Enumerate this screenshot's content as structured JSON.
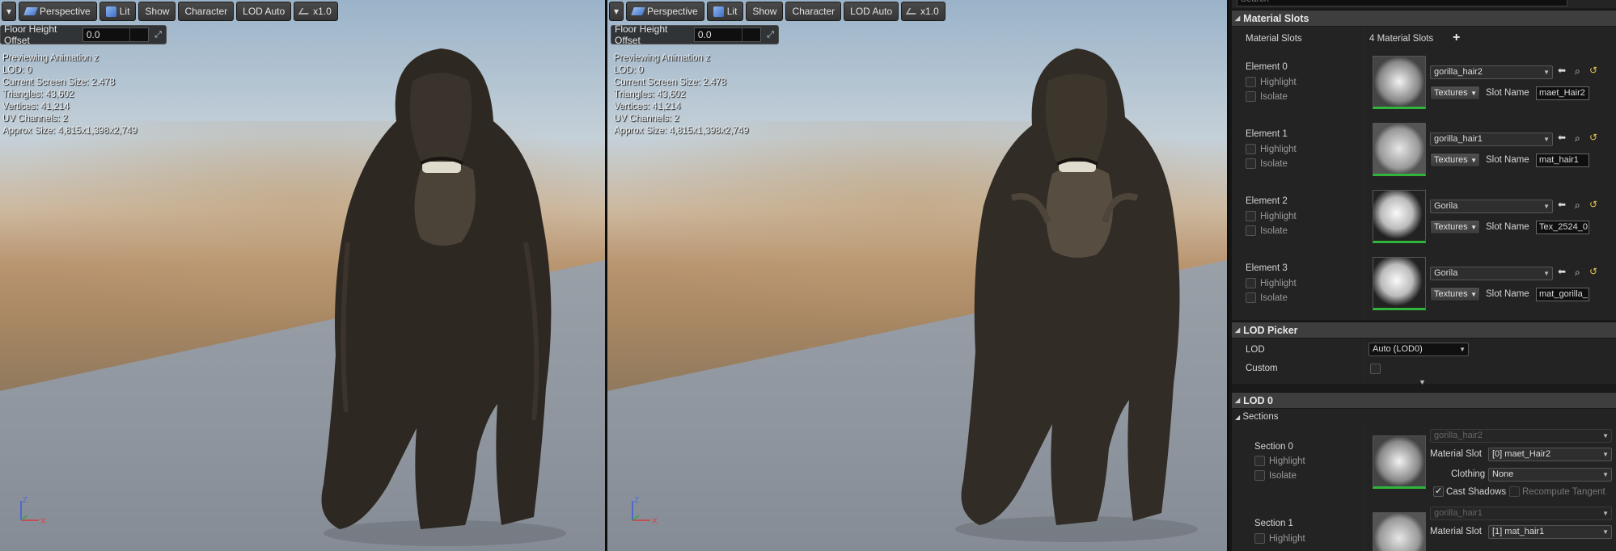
{
  "viewport_left": {
    "toolbar": {
      "menu_arrow": "▾",
      "perspective": "Perspective",
      "lit": "Lit",
      "show": "Show",
      "character": "Character",
      "lod": "LOD Auto",
      "speed": "x1.0"
    },
    "floor_label": "Floor Height Offset",
    "floor_value": "0.0",
    "stats": [
      "Previewing Animation z",
      "LOD: 0",
      "Current Screen Size: 2.478",
      "Triangles: 43,602",
      "Vertices: 41,214",
      "UV Channels: 2",
      "Approx Size: 4,815x1,398x2,749"
    ],
    "axis": {
      "z": "Z",
      "x": "X"
    }
  },
  "viewport_right": {
    "toolbar": {
      "menu_arrow": "▾",
      "perspective": "Perspective",
      "lit": "Lit",
      "show": "Show",
      "character": "Character",
      "lod": "LOD Auto",
      "speed": "x1.0"
    },
    "floor_label": "Floor Height Offset",
    "floor_value": "0.0",
    "stats": [
      "Previewing Animation z",
      "LOD: 0",
      "Current Screen Size: 2.478",
      "Triangles: 43,602",
      "Vertices: 41,214",
      "UV Channels: 2",
      "Approx Size: 4,815x1,398x2,749"
    ],
    "axis": {
      "z": "Z",
      "x": "X"
    }
  },
  "panel": {
    "search_placeholder": "Search",
    "material_slots": {
      "header": "Material Slots",
      "label": "Material Slots",
      "count": "4 Material Slots",
      "add": "+",
      "elements": [
        {
          "name": "Element 0",
          "material": "gorilla_hair2",
          "slot_name": "maet_Hair2"
        },
        {
          "name": "Element 1",
          "material": "gorilla_hair1",
          "slot_name": "mat_hair1"
        },
        {
          "name": "Element 2",
          "material": "Gorila",
          "slot_name": "Tex_2524_0"
        },
        {
          "name": "Element 3",
          "material": "Gorila",
          "slot_name": "mat_gorilla_"
        }
      ],
      "highlight": "Highlight",
      "isolate": "Isolate",
      "textures": "Textures",
      "slot_name_label": "Slot Name"
    },
    "lod_picker": {
      "header": "LOD Picker",
      "lod_label": "LOD",
      "lod_value": "Auto (LOD0)",
      "custom_label": "Custom"
    },
    "lod0": {
      "header": "LOD 0",
      "sections_label": "Sections",
      "sections": [
        {
          "name": "Section 0",
          "material": "gorilla_hair2",
          "material_slot": "[0] maet_Hair2",
          "clothing": "None"
        },
        {
          "name": "Section 1",
          "material": "gorilla_hair1",
          "material_slot": "[1] mat_hair1"
        }
      ],
      "material_slot_label": "Material Slot",
      "clothing_label": "Clothing",
      "cast_shadows": "Cast Shadows",
      "recompute_tangent": "Recompute Tangent",
      "highlight": "Highlight",
      "isolate": "Isolate"
    }
  }
}
